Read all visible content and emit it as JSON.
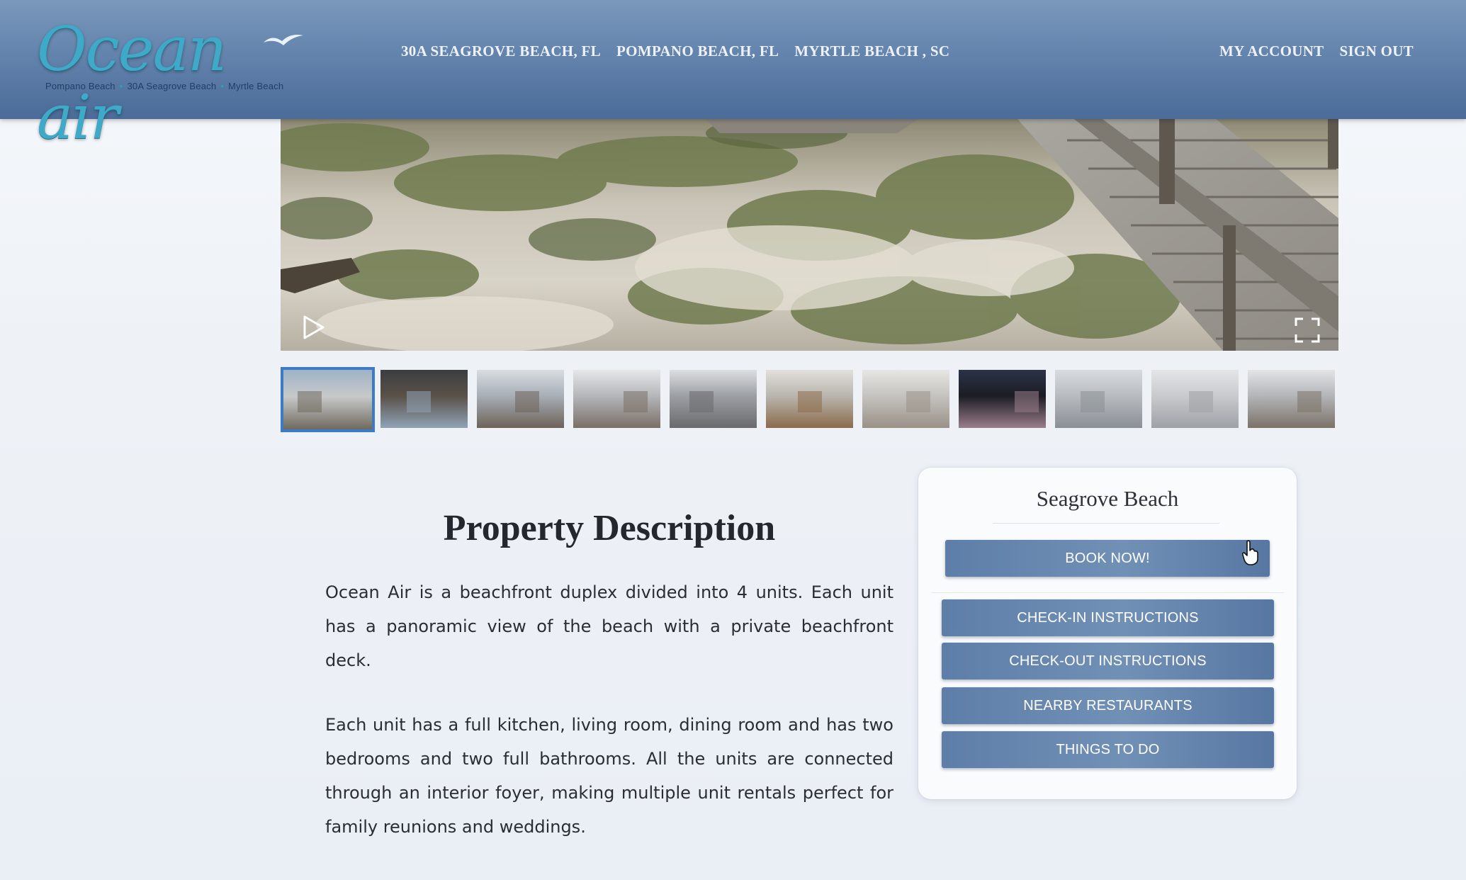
{
  "brand": {
    "logo_text": "Ocean air",
    "tagline_locations": [
      "Pompano Beach",
      "30A Seagrove Beach",
      "Myrtle Beach"
    ]
  },
  "nav": {
    "locations": [
      "30A SEAGROVE BEACH, FL",
      "POMPANO BEACH, FL",
      "MYRTLE BEACH , SC"
    ],
    "account": "MY ACCOUNT",
    "signout": "SIGN OUT"
  },
  "gallery": {
    "thumbnail_count": 11,
    "active_index": 0,
    "thumbnails": [
      {
        "subject": "beach-boardwalk",
        "colors": [
          "#9fb2c8",
          "#6f6a5f",
          "#c7c9c9"
        ]
      },
      {
        "subject": "balcony-door",
        "colors": [
          "#3b3d42",
          "#8fa3b5",
          "#5a5148"
        ]
      },
      {
        "subject": "living-room",
        "colors": [
          "#d9dde1",
          "#6e6258",
          "#a7aeb6"
        ]
      },
      {
        "subject": "bedroom",
        "colors": [
          "#e6e7e9",
          "#7a6f66",
          "#b4b6ba"
        ]
      },
      {
        "subject": "dining-living",
        "colors": [
          "#dcdfe2",
          "#6a6a6d",
          "#9c9fa4"
        ]
      },
      {
        "subject": "kitchen-dining",
        "colors": [
          "#e2e0dc",
          "#8c6b4b",
          "#b9b5ae"
        ]
      },
      {
        "subject": "kitchen",
        "colors": [
          "#e8e6e2",
          "#9a9188",
          "#c5c3bf"
        ]
      },
      {
        "subject": "sunset-beach",
        "colors": [
          "#2c3348",
          "#9a7f8c",
          "#1b1c24"
        ]
      },
      {
        "subject": "living-area",
        "colors": [
          "#d8dce0",
          "#8a8f96",
          "#b8bcc0"
        ]
      },
      {
        "subject": "laundry",
        "colors": [
          "#e4e5e7",
          "#9ea1a6",
          "#c8cacd"
        ]
      },
      {
        "subject": "bedroom-2",
        "colors": [
          "#e3e4e6",
          "#7c7268",
          "#b3b5b8"
        ]
      }
    ]
  },
  "description": {
    "title": "Property Description",
    "paragraphs": [
      "Ocean Air is a beachfront duplex divided into 4 units. Each unit has a panoramic view of the beach with a private beachfront deck.",
      "Each unit has a full kitchen, living room, dining room and has two bedrooms and two full bathrooms. All the units are connected through an interior foyer, making multiple unit rentals perfect for family reunions and weddings."
    ]
  },
  "sidebar": {
    "title": "Seagrove Beach",
    "book_label": "BOOK NOW!",
    "buttons": [
      "CHECK-IN INSTRUCTIONS",
      "CHECK-OUT INSTRUCTIONS",
      "NEARBY RESTAURANTS",
      "THINGS TO DO"
    ]
  },
  "colors": {
    "header_top": "#7b98bc",
    "header_bottom": "#4b6b98",
    "button": "#6586b0",
    "active_thumb_border": "#3d7cc4"
  }
}
